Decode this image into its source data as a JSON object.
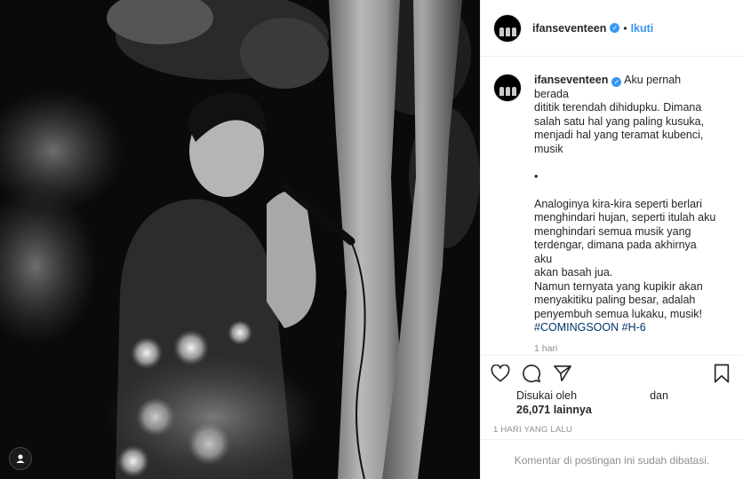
{
  "post": {
    "username": "ifanseventeen",
    "follow_label": "Ikuti",
    "separator": "•",
    "caption_lines": [
      "Aku pernah berada",
      "dititik terendah dihidupku. Dimana",
      "salah satu hal yang paling kusuka,",
      "menjadi hal yang teramat kubenci,",
      "musik"
    ],
    "caption_bullet": "•",
    "caption_lines_2": [
      "Analoginya kira-kira seperti berlari",
      "menghindari hujan, seperti itulah aku",
      "menghindari semua musik yang",
      "terdengar, dimana pada akhirnya aku",
      "akan basah jua.",
      "Namun ternyata yang kupikir akan",
      "menyakitiku paling besar, adalah",
      "penyembuh semua lukaku, musik!"
    ],
    "hashtags": "#COMINGSOON #H-6",
    "caption_time": "1 hari",
    "liked_by_prefix": "Disukai oleh",
    "liked_by_and": "dan",
    "likes_count": "26,071 lainnya",
    "posted_time": "1 HARI YANG LALU",
    "comments_disabled": "Komentar di postingan ini sudah dibatasi."
  },
  "icons": {
    "like": "heart-icon",
    "comment": "comment-icon",
    "share": "share-icon",
    "save": "bookmark-icon",
    "verified": "verified-badge-icon",
    "user_tag": "user-tag-icon"
  },
  "colors": {
    "link": "#3897f0",
    "hashtag": "#003569",
    "muted": "#8e8e8e",
    "border": "#efefef"
  }
}
